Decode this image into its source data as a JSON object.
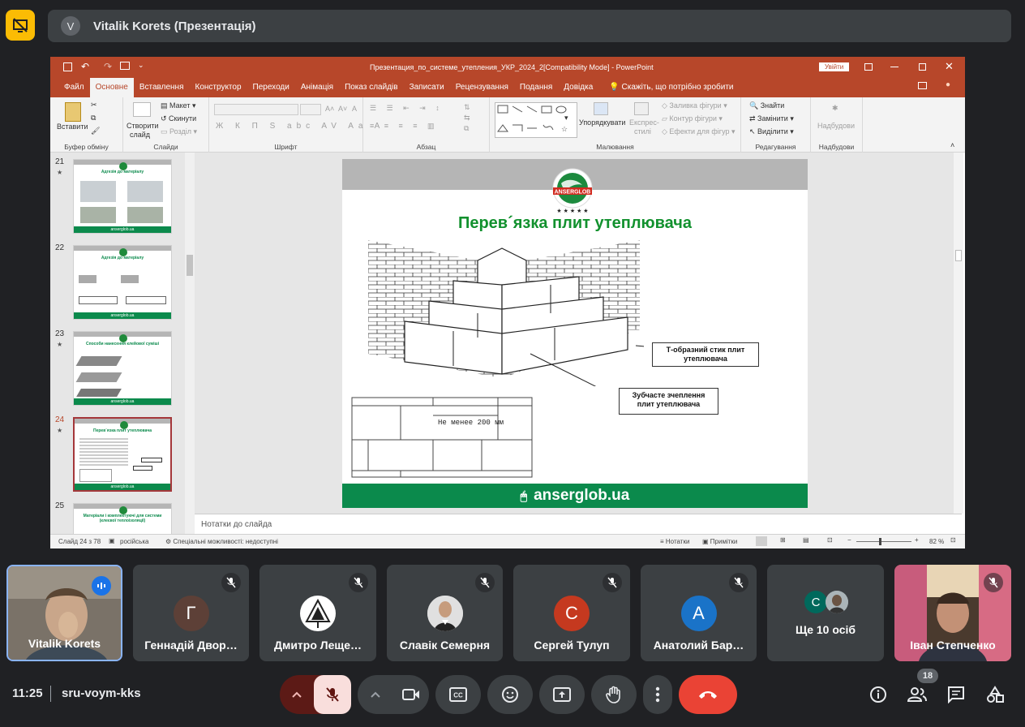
{
  "presenter": {
    "avatar_letter": "V",
    "title": "Vitalik Korets (Презентація)"
  },
  "powerpoint": {
    "window_title": "Презентация_по_системе_утепления_УКР_2024_2[Compatibility Mode]  -  PowerPoint",
    "signin": "Увійти",
    "tabs": [
      "Файл",
      "Основне",
      "Вставлення",
      "Конструктор",
      "Переходи",
      "Анімація",
      "Показ слайдів",
      "Записати",
      "Рецензування",
      "Подання",
      "Довідка"
    ],
    "active_tab": "Основне",
    "tell_me": "Скажіть, що потрібно зробити",
    "ribbon": {
      "paste": "Вставити",
      "clipboard": "Буфер обміну",
      "new_slide_1": "Створити",
      "new_slide_2": "слайд",
      "layout": "Макет",
      "reset": "Скинути",
      "section": "Розділ",
      "slides": "Слайди",
      "font": "Шрифт",
      "paragraph": "Абзац",
      "arrange_1": "Упорядкувати",
      "quick_styles_1": "Експрес-",
      "quick_styles_2": "стилі",
      "shape_fill": "Заливка фігури",
      "shape_outline": "Контур фігури",
      "shape_effects": "Ефекти для фігур",
      "drawing": "Малювання",
      "find": "Знайти",
      "replace": "Замінити",
      "select": "Виділити",
      "editing": "Редагування",
      "addins_btn": "Надбудови",
      "addins": "Надбудови"
    },
    "thumbnails": [
      {
        "num": "21",
        "title": "Адгезія до матеріалу",
        "footer": "anserglob.ua"
      },
      {
        "num": "22",
        "title": "Адгезія до матеріалу",
        "footer": "anserglob.ua"
      },
      {
        "num": "23",
        "title": "Способи нанесення клейової суміші",
        "footer": "anserglob.ua"
      },
      {
        "num": "24",
        "title": "Перев´язка плит утеплювача",
        "footer": "anserglob.ua"
      },
      {
        "num": "25",
        "title": "Матеріали і комплектуючі для системи (клеєвої теплоізоляції)",
        "footer": ""
      }
    ],
    "slide": {
      "logo_text": "ANSERGLOB",
      "title": "Перев´язка плит утеплювача",
      "callout_1_line1": "Т-образний стик плит",
      "callout_1_line2": "утеплювача",
      "callout_2_line1": "Зубчасте зчеплення",
      "callout_2_line2": "плит утеплювача",
      "dimension": "Не менее 200 мм",
      "footer": "anserglob.ua"
    },
    "notes_placeholder": "Нотатки до слайда",
    "status": {
      "slide_of": "Слайд 24 з 78",
      "language": "російська",
      "accessibility": "Спеціальні можливості: недоступні",
      "notes": "Нотатки",
      "comments": "Примітки",
      "zoom": "82 %"
    }
  },
  "participants": [
    {
      "name": "Vitalik Korets",
      "kind": "video",
      "speaking": true
    },
    {
      "name": "Геннадій Двор…",
      "letter": "Г",
      "color": "#5d4037"
    },
    {
      "name": "Дмитро Леще…",
      "kind": "logo"
    },
    {
      "name": "Славік Семерня",
      "kind": "photo"
    },
    {
      "name": "Сергей Тулуп",
      "letter": "С",
      "color": "#c5391f"
    },
    {
      "name": "Анатолий Бар…",
      "letter": "A",
      "color": "#1a73c8"
    },
    {
      "name": "Ще 10 осіб",
      "letter": "С",
      "color": "#00695c"
    },
    {
      "name": "Іван Степченко",
      "kind": "video"
    }
  ],
  "meeting": {
    "time": "11:25",
    "code": "sru-voym-kks",
    "participant_count": "18"
  }
}
